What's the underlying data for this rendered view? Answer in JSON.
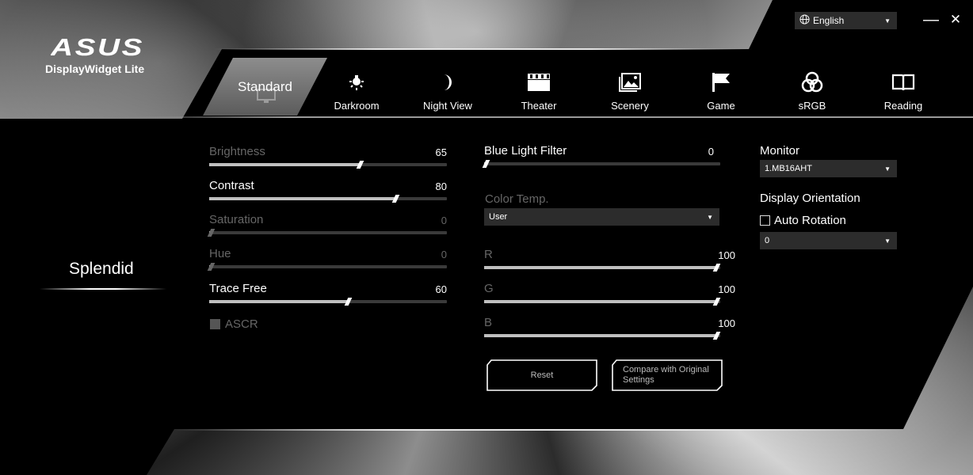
{
  "app": {
    "brand": "ASUS",
    "title": "DisplayWidget Lite"
  },
  "language": {
    "value": "English"
  },
  "window": {
    "minimize": "—",
    "close": "✕"
  },
  "tabs": [
    {
      "label": "Standard",
      "icon": "monitor-icon",
      "active": true
    },
    {
      "label": "Darkroom",
      "icon": "lamp-icon"
    },
    {
      "label": "Night View",
      "icon": "moon-icon"
    },
    {
      "label": "Theater",
      "icon": "clapperboard-icon"
    },
    {
      "label": "Scenery",
      "icon": "landscape-icon"
    },
    {
      "label": "Game",
      "icon": "flag-icon"
    },
    {
      "label": "sRGB",
      "icon": "rgb-circles-icon"
    },
    {
      "label": "Reading",
      "icon": "book-icon"
    }
  ],
  "sidebar": {
    "title": "Splendid"
  },
  "sliders": [
    {
      "label": "Brightness",
      "value": "65",
      "level": 65,
      "enabled": false
    },
    {
      "label": "Contrast",
      "value": "80",
      "level": 80,
      "enabled": true
    },
    {
      "label": "Saturation",
      "value": "0",
      "level": 0,
      "enabled": false
    },
    {
      "label": "Hue",
      "value": "0",
      "level": 0,
      "enabled": false
    },
    {
      "label": "Trace Free",
      "value": "60",
      "level": 60,
      "enabled": true
    }
  ],
  "ascr": {
    "label": "ASCR"
  },
  "blue_light": {
    "label": "Blue Light Filter",
    "value": "0",
    "level": 0
  },
  "color_temp": {
    "label": "Color Temp.",
    "value": "User"
  },
  "rgb": [
    {
      "label": "R",
      "value": "100",
      "level": 100
    },
    {
      "label": "G",
      "value": "100",
      "level": 100
    },
    {
      "label": "B",
      "value": "100",
      "level": 100
    }
  ],
  "buttons": {
    "reset": "Reset",
    "compare": "Compare with Original Settings"
  },
  "monitor": {
    "label": "Monitor",
    "value": "1.MB16AHT"
  },
  "orientation": {
    "label": "Display Orientation",
    "auto_rotation": "Auto Rotation",
    "value": "0"
  }
}
